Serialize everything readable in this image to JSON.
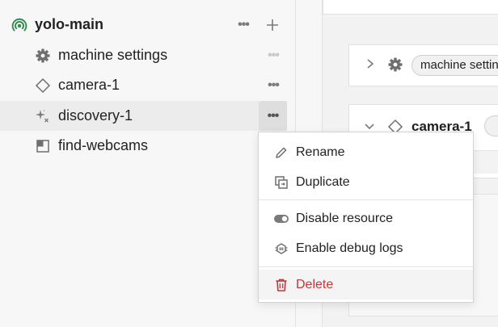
{
  "sidebar": {
    "machine": {
      "name": "yolo-main"
    },
    "items": [
      {
        "label": "machine settings"
      },
      {
        "label": "camera-1"
      },
      {
        "label": "discovery-1"
      },
      {
        "label": "find-webcams"
      }
    ],
    "more_glyph": "•••",
    "add_glyph": "+"
  },
  "main": {
    "machine_settings_pill": "machine settings",
    "camera_title": "camera-1"
  },
  "menu": {
    "items": [
      {
        "label": "Rename",
        "icon": "pencil-icon"
      },
      {
        "label": "Duplicate",
        "icon": "duplicate-icon"
      },
      {
        "label": "Disable resource",
        "icon": "toggle-icon"
      },
      {
        "label": "Enable debug logs",
        "icon": "bug-icon"
      },
      {
        "label": "Delete",
        "icon": "trash-icon"
      }
    ]
  },
  "colors": {
    "danger": "#c2353a",
    "online": "#2f8a4e"
  }
}
